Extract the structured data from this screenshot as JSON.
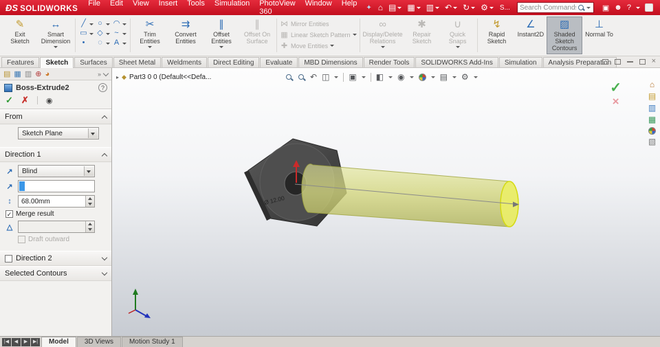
{
  "titlebar": {
    "logo_ds": "ÐS",
    "logo_text": "SOLIDWORKS",
    "menus": [
      "File",
      "Edit",
      "View",
      "Insert",
      "Tools",
      "Simulation",
      "PhotoView 360",
      "Window",
      "Help"
    ],
    "s_label": "S...",
    "search_placeholder": "Search Commands",
    "help_label": "?"
  },
  "icons": {
    "home": "⌂",
    "open": "▤",
    "save": "▦",
    "print": "▥",
    "undo": "↶",
    "redo": "↻",
    "gear": "⚙",
    "fullscreen": "▣",
    "user": "☻",
    "pin": "✦",
    "exit_sketch": "✎",
    "smart_dimension": "↔",
    "line": "╱",
    "circle": "○",
    "arc": "◠",
    "rectangle": "▭",
    "polygon": "◇",
    "spline": "~",
    "point": "•",
    "ellipse": "◌",
    "text": "A",
    "trim": "✂",
    "convert": "⇉",
    "offset": "∥",
    "offset_surface": "∥",
    "mirror": "⋈",
    "linear_pattern": "▦",
    "move": "✚",
    "display_delete": "∞",
    "repair": "✱",
    "quick_snaps": "∪",
    "rapid_sketch": "↯",
    "instant2d": "∠",
    "shaded_contours": "▨",
    "normal_to": "⊥",
    "pm_feature": "▤",
    "pm_property": "▦",
    "pm_config": "▥",
    "pm_dimxpert": "⊕",
    "pm_display": "◕",
    "check": "✓",
    "cross": "✗",
    "eye": "◉",
    "flip_arrow": "↗",
    "depth": "↕",
    "draft": "△",
    "breadcrumb_arrow": "▸",
    "part": "◆",
    "prev_view": "↶",
    "section_view": "◫",
    "view_orientation": "▣",
    "display_style": "◧",
    "hide_show": "◉",
    "scene": "▤",
    "view_settings": "⚙",
    "confirm_check": "✓",
    "confirm_cross": "×",
    "tp_home": "⌂",
    "tp_library": "▤",
    "tp_explorer": "▥",
    "tp_palette": "▦",
    "tp_props": "▧",
    "nav_first": "|◀",
    "nav_prev": "◀",
    "nav_next": "▶",
    "nav_last": "▶|"
  },
  "ribbon": {
    "exit_sketch": "Exit Sketch",
    "smart_dimension": "Smart Dimension",
    "trim": "Trim Entities",
    "convert": "Convert Entities",
    "offset": "Offset Entities",
    "offset_surface": "Offset On Surface",
    "mirror": "Mirror Entities",
    "linear_pattern": "Linear Sketch Pattern",
    "move": "Move Entities",
    "display_delete": "Display/Delete Relations",
    "repair": "Repair Sketch",
    "quick_snaps": "Quick Snaps",
    "rapid_sketch": "Rapid Sketch",
    "instant2d": "Instant2D",
    "shaded_contours": "Shaded Sketch Contours",
    "normal_to": "Normal To"
  },
  "tabs": [
    "Features",
    "Sketch",
    "Surfaces",
    "Sheet Metal",
    "Weldments",
    "Direct Editing",
    "Evaluate",
    "MBD Dimensions",
    "Render Tools",
    "SOLIDWORKS Add-Ins",
    "Simulation",
    "Analysis Preparation"
  ],
  "pm": {
    "title": "Boss-Extrude2",
    "from_label": "From",
    "from_value": "Sketch Plane",
    "dir1_label": "Direction 1",
    "dir1_type": "Blind",
    "depth_value": "68.00mm",
    "merge_label": "Merge result",
    "draft_label": "Draft outward",
    "dir2_label": "Direction 2",
    "contours_label": "Selected Contours"
  },
  "viewport": {
    "breadcrumb": "Part3 0 0 (Default<<Defa...",
    "dimension": "Ø 12.00"
  },
  "statusbar": {
    "tabs": [
      "Model",
      "3D Views",
      "Motion Study 1"
    ]
  }
}
